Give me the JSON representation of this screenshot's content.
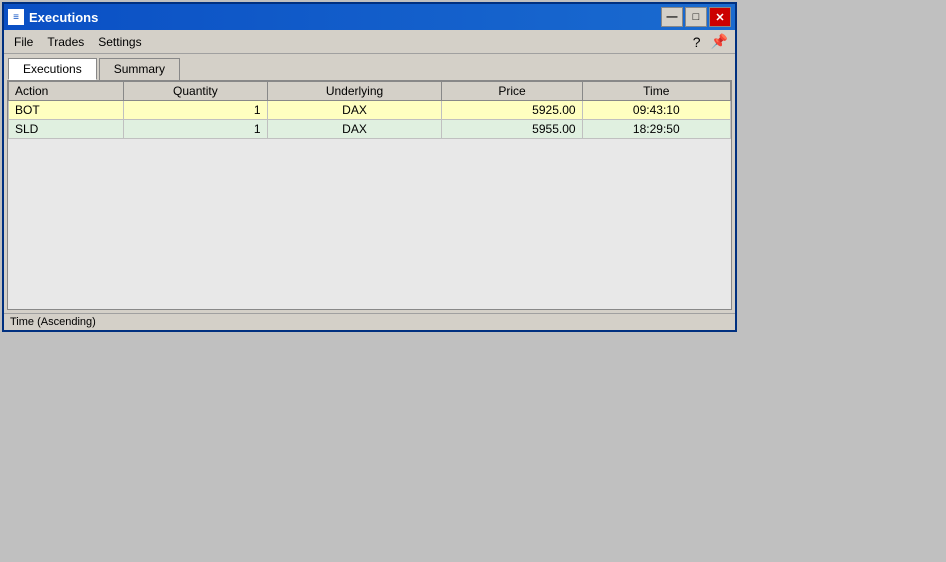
{
  "window": {
    "title": "Executions",
    "title_icon": "E",
    "minimize_btn": "—",
    "maximize_btn": "□",
    "close_btn": "✕"
  },
  "menu": {
    "items": [
      "File",
      "Trades",
      "Settings"
    ],
    "icons": [
      "?",
      "📌"
    ]
  },
  "tabs": [
    {
      "label": "Executions",
      "active": true
    },
    {
      "label": "Summary",
      "active": false
    }
  ],
  "table": {
    "columns": [
      "Action",
      "Quantity",
      "Underlying",
      "Price",
      "Time"
    ],
    "rows": [
      {
        "action": "BOT",
        "quantity": "1",
        "underlying": "DAX",
        "price": "5925.00",
        "time": "09:43:10",
        "style": "bot"
      },
      {
        "action": "SLD",
        "quantity": "1",
        "underlying": "DAX",
        "price": "5955.00",
        "time": "18:29:50",
        "style": "sld"
      }
    ]
  },
  "status_bar": {
    "text": "Time (Ascending)"
  }
}
